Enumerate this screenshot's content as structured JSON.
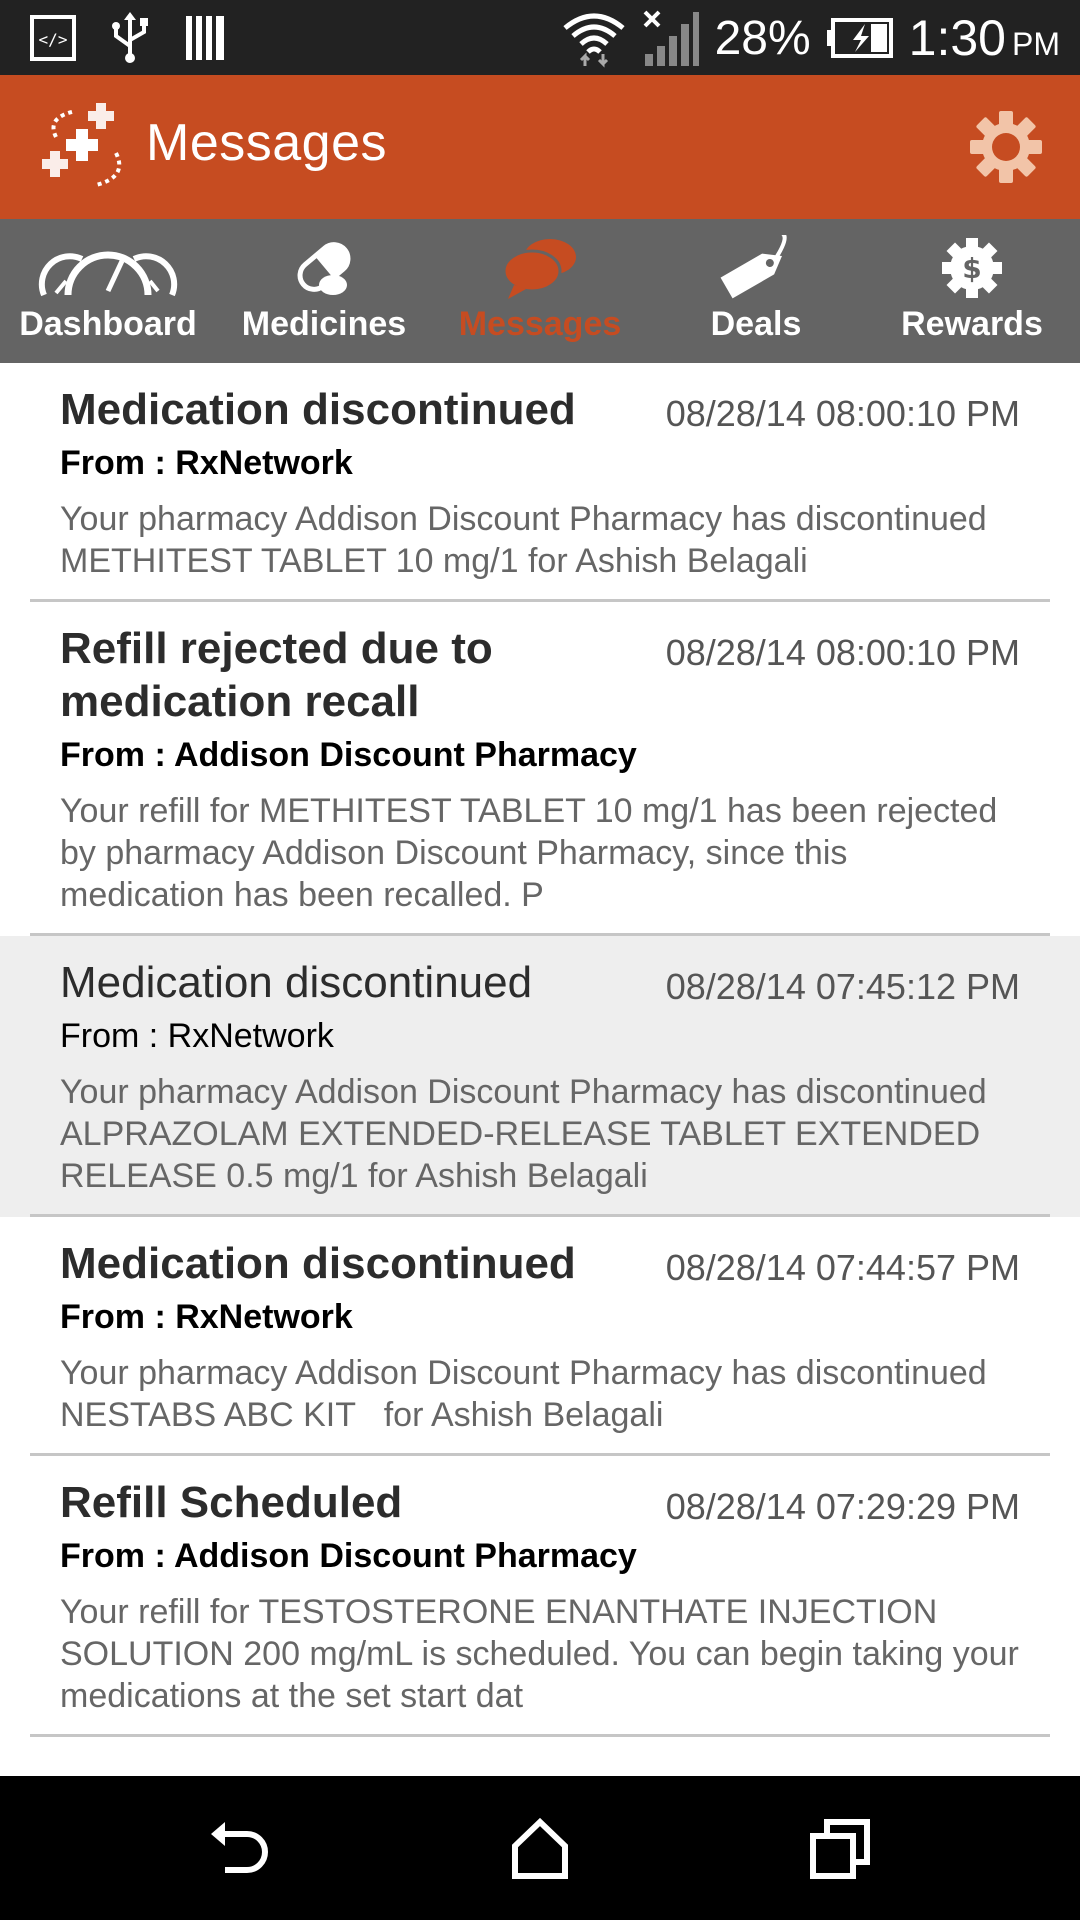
{
  "status_bar": {
    "battery": "28%",
    "time": "1:30",
    "ampm": "PM"
  },
  "header": {
    "title": "Messages"
  },
  "tabs": [
    {
      "label": "Dashboard",
      "icon": "dashboard-gauge-icon"
    },
    {
      "label": "Medicines",
      "icon": "pill-icon"
    },
    {
      "label": "Messages",
      "icon": "chat-bubbles-icon",
      "active": true
    },
    {
      "label": "Deals",
      "icon": "tag-icon"
    },
    {
      "label": "Rewards",
      "icon": "dollar-badge-icon"
    }
  ],
  "messages": [
    {
      "title": "Medication discontinued",
      "date": "08/28/14 08:00:10 PM",
      "from": "From : RxNetwork",
      "body": "Your pharmacy Addison Discount Pharmacy has discontinued METHITEST TABLET 10 mg/1 for Ashish Belagali",
      "read": false
    },
    {
      "title": "Refill rejected due to medication recall",
      "date": "08/28/14 08:00:10 PM",
      "from": "From : Addison Discount Pharmacy",
      "body": "Your refill for METHITEST TABLET 10 mg/1 has been rejected by pharmacy Addison Discount Pharmacy, since this medication has been recalled. P",
      "read": false
    },
    {
      "title": "Medication discontinued",
      "date": "08/28/14 07:45:12 PM",
      "from": "From : RxNetwork",
      "body": "Your pharmacy Addison Discount Pharmacy has discontinued ALPRAZOLAM EXTENDED-RELEASE TABLET EXTENDED RELEASE 0.5 mg/1 for Ashish Belagali",
      "read": true
    },
    {
      "title": "Medication discontinued",
      "date": "08/28/14 07:44:57 PM",
      "from": "From : RxNetwork",
      "body": "Your pharmacy Addison Discount Pharmacy has discontinued NESTABS ABC KIT   for Ashish Belagali",
      "read": false
    },
    {
      "title": "Refill Scheduled",
      "date": "08/28/14 07:29:29 PM",
      "from": "From : Addison Discount Pharmacy",
      "body": "Your refill for TESTOSTERONE ENANTHATE INJECTION SOLUTION 200 mg/mL is scheduled. You can begin taking your medications at the set start dat",
      "read": false
    }
  ],
  "colors": {
    "accent": "#c64c21",
    "tab_bar": "#646464",
    "status_bar": "#222222",
    "read_row": "#eeeeee"
  }
}
